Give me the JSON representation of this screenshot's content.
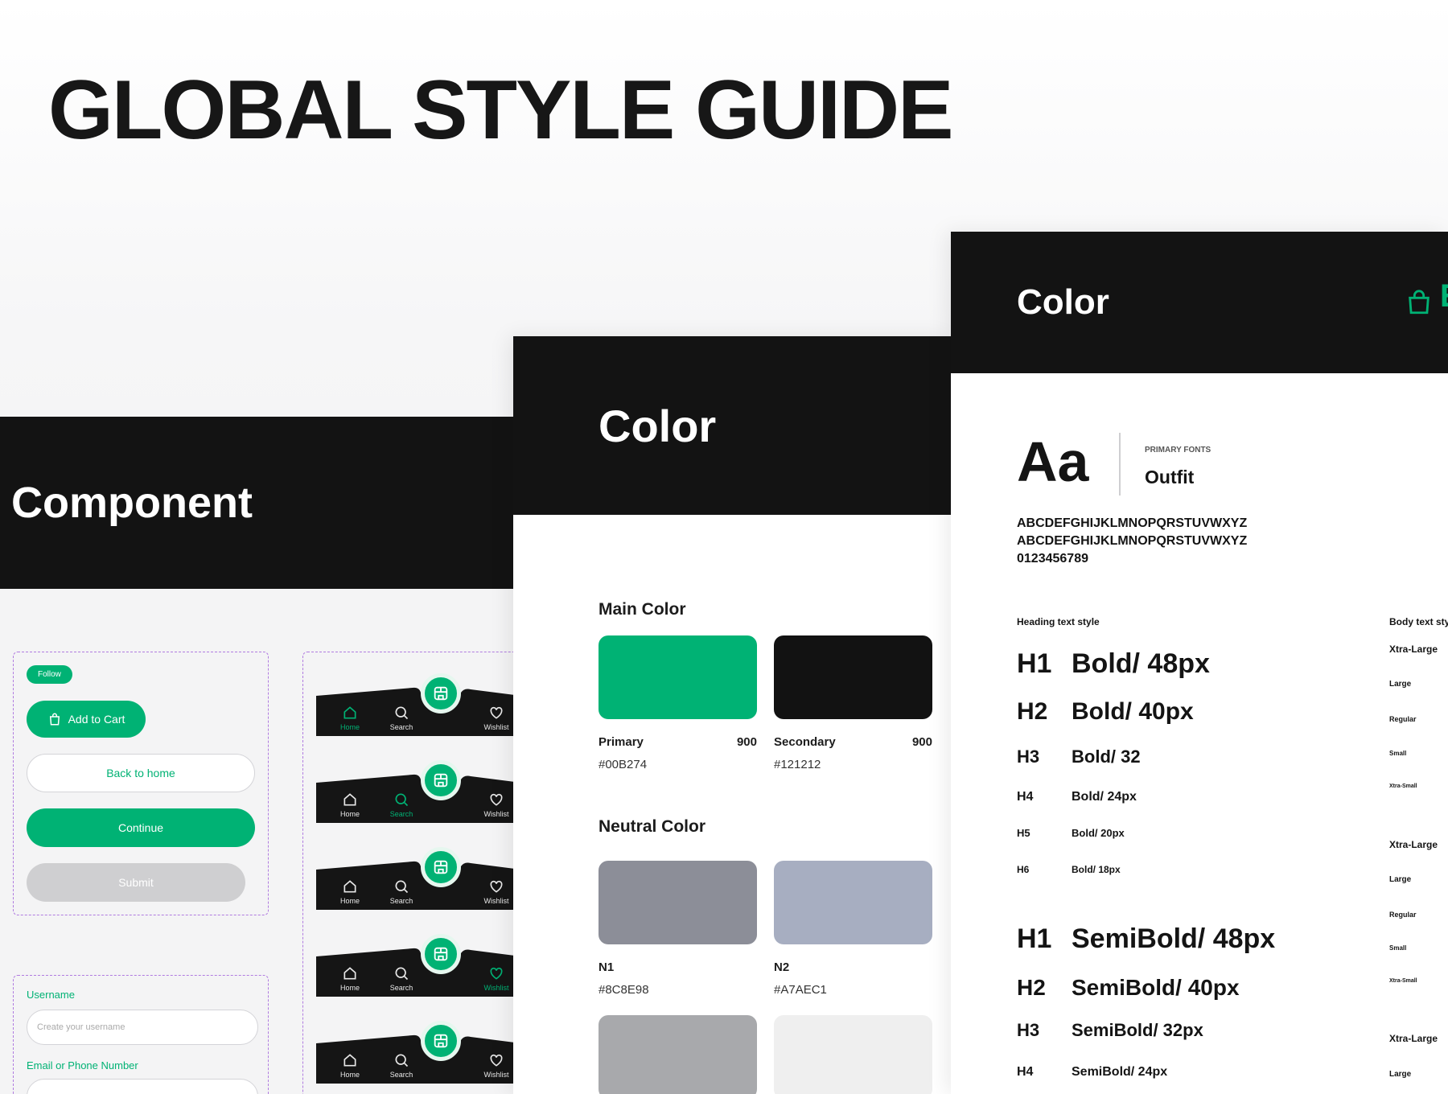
{
  "title": "GLOBAL STYLE GUIDE",
  "component": {
    "heading": "Component",
    "follow": "Follow",
    "add_to_cart": "Add to Cart",
    "back_to_home": "Back to home",
    "continue": "Continue",
    "submit": "Submit",
    "username_label": "Username",
    "username_placeholder": "Create your username",
    "email_label": "Email or Phone Number",
    "nav": {
      "home": "Home",
      "search": "Search",
      "wishlist": "Wishlist"
    }
  },
  "color": {
    "heading": "Color",
    "main_title": "Main Color",
    "neutral_title": "Neutral Color",
    "main": [
      {
        "name": "Primary",
        "shade": "900",
        "hex": "#00B274",
        "color": "#00b274"
      },
      {
        "name": "Secondary",
        "shade": "900",
        "hex": "#121212",
        "color": "#121212"
      }
    ],
    "neutral": [
      {
        "name": "N1",
        "hex": "#8C8E98",
        "color": "#8c8e98"
      },
      {
        "name": "N2",
        "hex": "#A7AEC1",
        "color": "#a7aec1"
      }
    ],
    "neutral_extra": [
      "#a8a9ac",
      "#efefef"
    ]
  },
  "typography": {
    "heading": "Color",
    "brand_initial": "E",
    "sample": "Aa",
    "primary_fonts_label": "PRIMARY FONTS",
    "font_name": "Outfit",
    "alphabet_upper": "ABCDEFGHIJKLMNOPQRSTUVWXYZ",
    "alphabet_lower": "ABCDEFGHIJKLMNOPQRSTUVWXYZ",
    "digits": "0123456789",
    "heading_style_label": "Heading text style",
    "body_style_label": "Body text sty",
    "bold": [
      {
        "tag": "H1",
        "value": "Bold/ 48px"
      },
      {
        "tag": "H2",
        "value": "Bold/ 40px"
      },
      {
        "tag": "H3",
        "value": "Bold/ 32"
      },
      {
        "tag": "H4",
        "value": "Bold/ 24px"
      },
      {
        "tag": "H5",
        "value": "Bold/ 20px"
      },
      {
        "tag": "H6",
        "value": "Bold/ 18px"
      }
    ],
    "semibold": [
      {
        "tag": "H1",
        "value": "SemiBold/ 48px"
      },
      {
        "tag": "H2",
        "value": "SemiBold/ 40px"
      },
      {
        "tag": "H3",
        "value": "SemiBold/ 32px"
      },
      {
        "tag": "H4",
        "value": "SemiBold/ 24px"
      }
    ],
    "body": [
      "Xtra-Large",
      "Large",
      "Regular",
      "Small",
      "Xtra-Small",
      "Xtra-Large",
      "Large",
      "Regular",
      "Small",
      "Xtra-Small",
      "Xtra-Large",
      "Large"
    ]
  }
}
